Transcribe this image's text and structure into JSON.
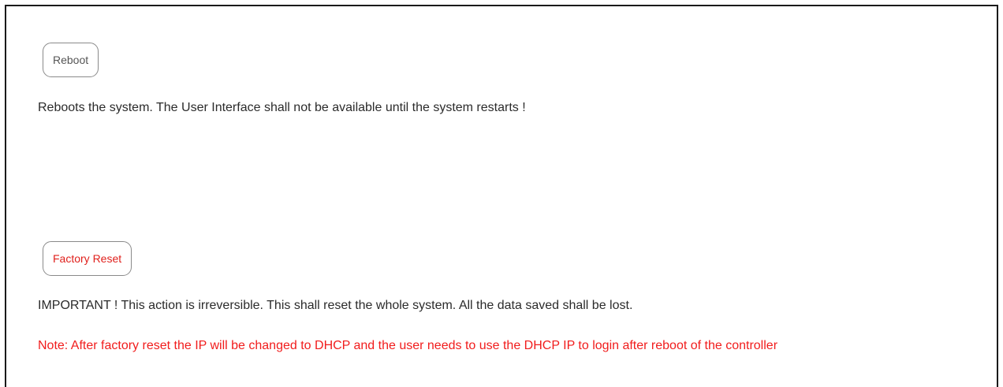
{
  "reboot": {
    "button_label": "Reboot",
    "description": "Reboots the system. The User Interface shall not be available until the system restarts !"
  },
  "factory_reset": {
    "button_label": "Factory Reset",
    "warning": "IMPORTANT ! This action is irreversible. This shall reset the whole system. All the data saved shall be lost.",
    "note": "Note: After factory reset the IP will be changed to DHCP and the user needs to use the DHCP IP to login after reboot of the controller"
  },
  "colors": {
    "warning_red": "#f11c1c",
    "text": "#2b2b2b",
    "button_border": "#8a8a8a"
  }
}
